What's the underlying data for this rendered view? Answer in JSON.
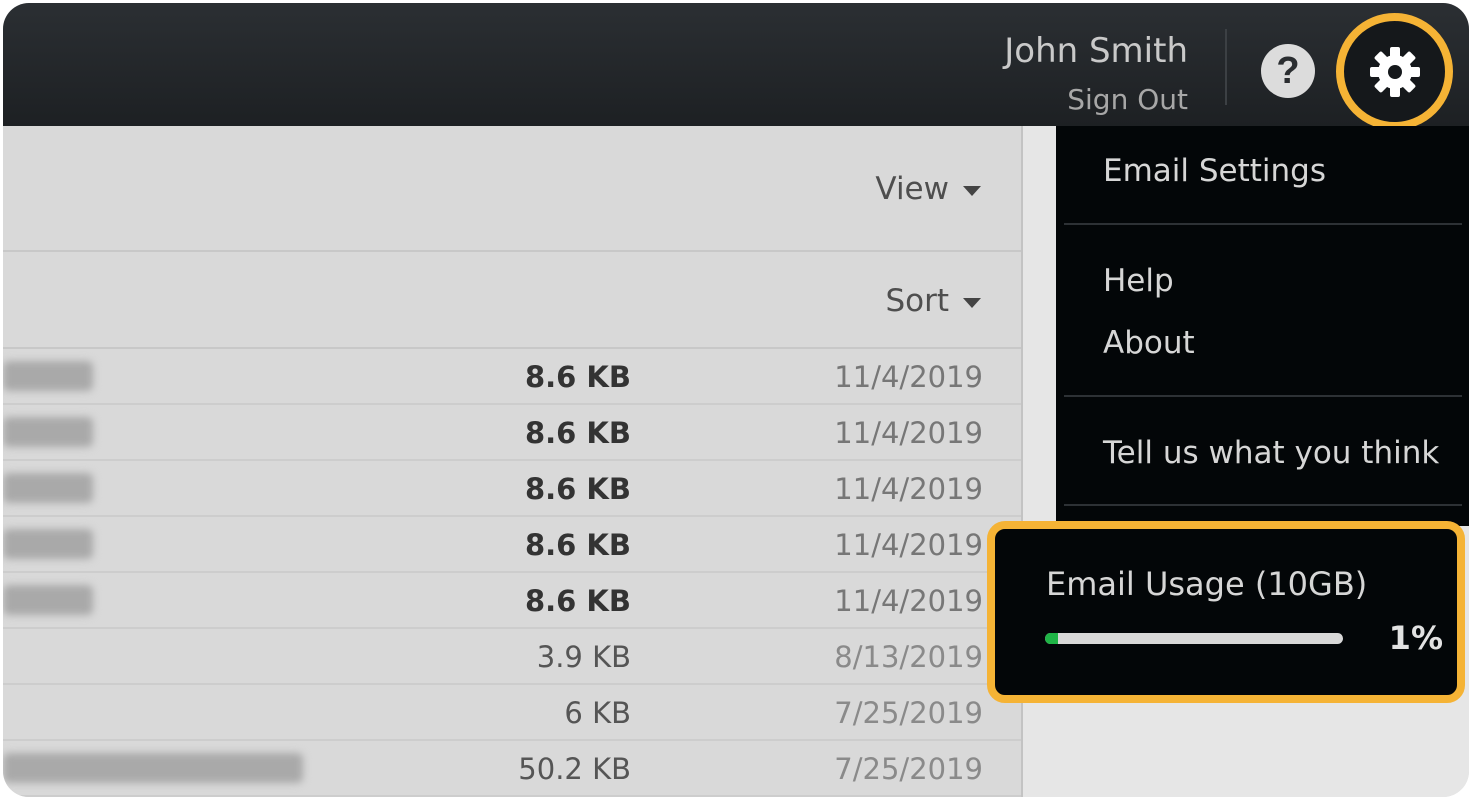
{
  "header": {
    "user_name": "John Smith",
    "sign_out": "Sign Out",
    "help_icon_glyph": "?",
    "icons": [
      "help-icon",
      "gear-icon"
    ]
  },
  "toolbar": {
    "view_label": "View",
    "sort_label": "Sort"
  },
  "messages": [
    {
      "size": "8.6 KB",
      "date": "11/4/2019",
      "unread": true
    },
    {
      "size": "8.6 KB",
      "date": "11/4/2019",
      "unread": true
    },
    {
      "size": "8.6 KB",
      "date": "11/4/2019",
      "unread": true
    },
    {
      "size": "8.6 KB",
      "date": "11/4/2019",
      "unread": true
    },
    {
      "size": "8.6 KB",
      "date": "11/4/2019",
      "unread": true
    },
    {
      "size": "3.9 KB",
      "date": "8/13/2019",
      "unread": false
    },
    {
      "size": "6 KB",
      "date": "7/25/2019",
      "unread": false
    },
    {
      "size": "50.2 KB",
      "date": "7/25/2019",
      "unread": false
    }
  ],
  "settings_menu": {
    "items": [
      "Email Settings",
      "Help",
      "About",
      "Tell us what you think"
    ]
  },
  "usage": {
    "title": "Email Usage (10GB)",
    "percent_label": "1%",
    "percent_value": 0.01
  },
  "colors": {
    "highlight": "#f5b335",
    "usage_fill": "#1fb446",
    "menu_bg": "#030608",
    "topbar_bg": "#202326"
  }
}
